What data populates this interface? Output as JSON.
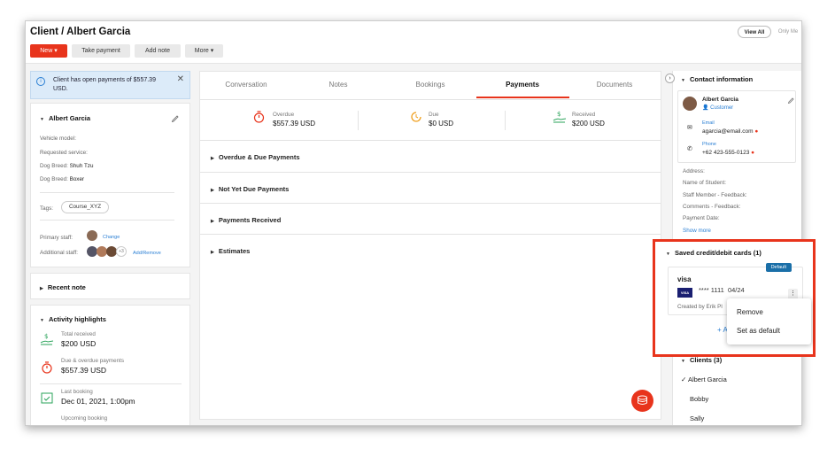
{
  "header": {
    "title": "Client / Albert Garcia",
    "new_label": "New",
    "take_payment_label": "Take payment",
    "add_note_label": "Add note",
    "more_label": "More",
    "view_all_label": "View All",
    "only_me_label": "Only Me"
  },
  "alert": {
    "text": "Client has open payments of $557.39 USD."
  },
  "client": {
    "name": "Albert Garcia",
    "vehicle_model_label": "Vehicle model:",
    "requested_service_label": "Requested service:",
    "dog_breed_1_label": "Dog Breed:",
    "dog_breed_1_value": "Shuh Tzu",
    "dog_breed_2_label": "Dog Breed:",
    "dog_breed_2_value": "Boxer",
    "tags_label": "Tags:",
    "tag": "Course_XYZ",
    "primary_staff_label": "Primary staff:",
    "change_label": "Change",
    "additional_staff_label": "Additional staff:",
    "additional_count": "+3",
    "add_remove_label": "Add/Remove"
  },
  "recent_note": {
    "label": "Recent note"
  },
  "activity": {
    "heading": "Activity highlights",
    "total_received_label": "Total received",
    "total_received_value": "$200 USD",
    "due_label": "Due & overdue payments",
    "due_value": "$557.39 USD",
    "last_booking_label": "Last booking",
    "last_booking_value": "Dec 01, 2021, 1:00pm",
    "upcoming_label": "Upcoming booking"
  },
  "tabs": [
    "Conversation",
    "Notes",
    "Bookings",
    "Payments",
    "Documents"
  ],
  "summary": {
    "overdue_label": "Overdue",
    "overdue_value": "$557.39 USD",
    "due_label": "Due",
    "due_value": "$0 USD",
    "received_label": "Received",
    "received_value": "$200 USD"
  },
  "sections": [
    "Overdue & Due Payments",
    "Not Yet Due Payments",
    "Payments Received",
    "Estimates"
  ],
  "contact": {
    "heading": "Contact information",
    "name": "Albert Garcia",
    "role": "Customer",
    "email_label": "Email",
    "email": "agarcia@email.com",
    "phone_label": "Phone",
    "phone": "+62 423-555-0123",
    "fields": [
      "Address:",
      "Name of Student:",
      "Staff Member - Feedback:",
      "Comments - Feedback:",
      "Payment Date:"
    ],
    "show_more": "Show more"
  },
  "cards": {
    "heading": "Saved credit/debit cards (1)",
    "default_badge": "Default",
    "brand": "visa",
    "brand_logo": "VISA",
    "number": "**** 1111",
    "expiry": "04/24",
    "created_by": "Created by Erik Pl",
    "add_label": "+ A",
    "menu_remove": "Remove",
    "menu_set_default": "Set as default"
  },
  "clients": {
    "heading": "Clients (3)",
    "items": [
      "Albert Garcia",
      "Bobby",
      "Sally"
    ]
  },
  "colors": {
    "accent": "#e8341c",
    "link": "#2a7fd4",
    "badge": "#1a6fa8"
  }
}
